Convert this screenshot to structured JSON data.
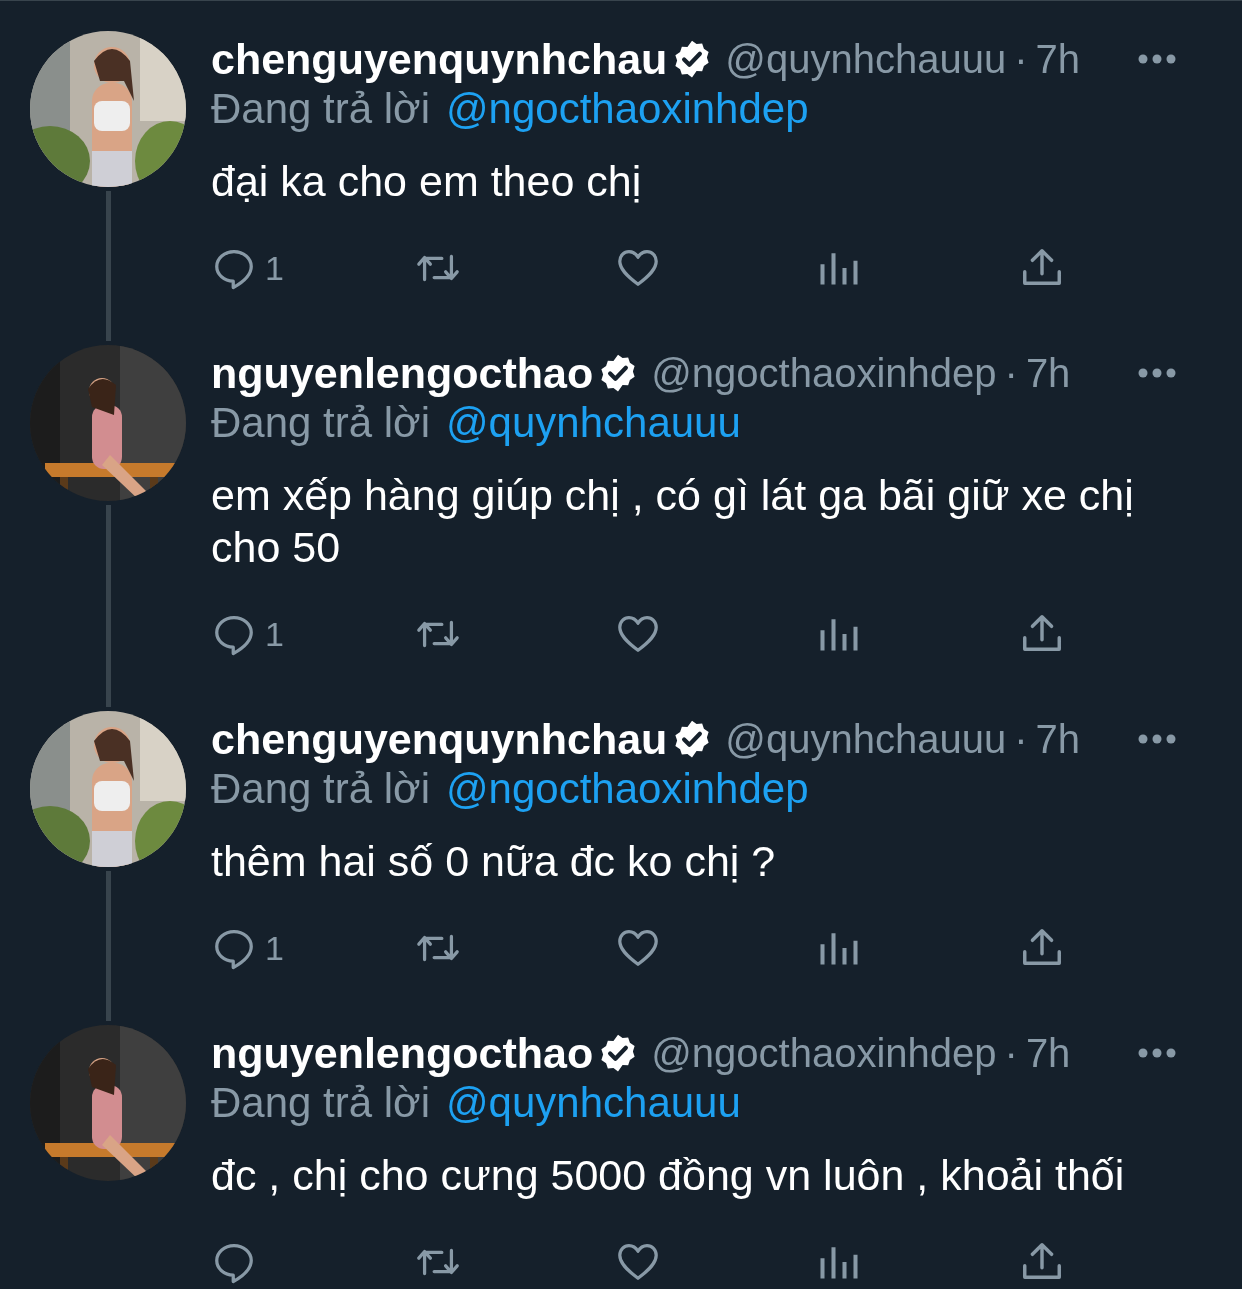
{
  "tweets": [
    {
      "display_name": "chenguyenquynhchau",
      "verified": true,
      "handle": "@quynhchauuu",
      "separator": "·",
      "time": "7h",
      "replying_label": "Đang trả lời",
      "replying_to": "@ngocthaoxinhdep",
      "text": "đại ka cho em theo chị",
      "reply_count": "1",
      "thread_line": true
    },
    {
      "display_name": "nguyenlengocthao",
      "verified": true,
      "handle": "@ngocthaoxinhdep",
      "separator": "·",
      "time": "7h",
      "replying_label": "Đang trả lời",
      "replying_to": "@quynhchauuu",
      "text": "em xếp hàng giúp chị , có gì lát ga bãi giữ xe chị cho 50",
      "reply_count": "1",
      "thread_line": true
    },
    {
      "display_name": "chenguyenquynhchau",
      "verified": true,
      "handle": "@quynhchauuu",
      "separator": "·",
      "time": "7h",
      "replying_label": "Đang trả lời",
      "replying_to": "@ngocthaoxinhdep",
      "text": "thêm hai số 0 nữa đc ko chị ?",
      "reply_count": "1",
      "thread_line": true
    },
    {
      "display_name": "nguyenlengocthao",
      "verified": true,
      "handle": "@ngocthaoxinhdep",
      "separator": "·",
      "time": "7h",
      "replying_label": "Đang trả lời",
      "replying_to": "@quynhchauuu",
      "text": "đc , chị cho cưng 5000 đồng vn luôn , khoải thối",
      "thread_line": false
    }
  ]
}
